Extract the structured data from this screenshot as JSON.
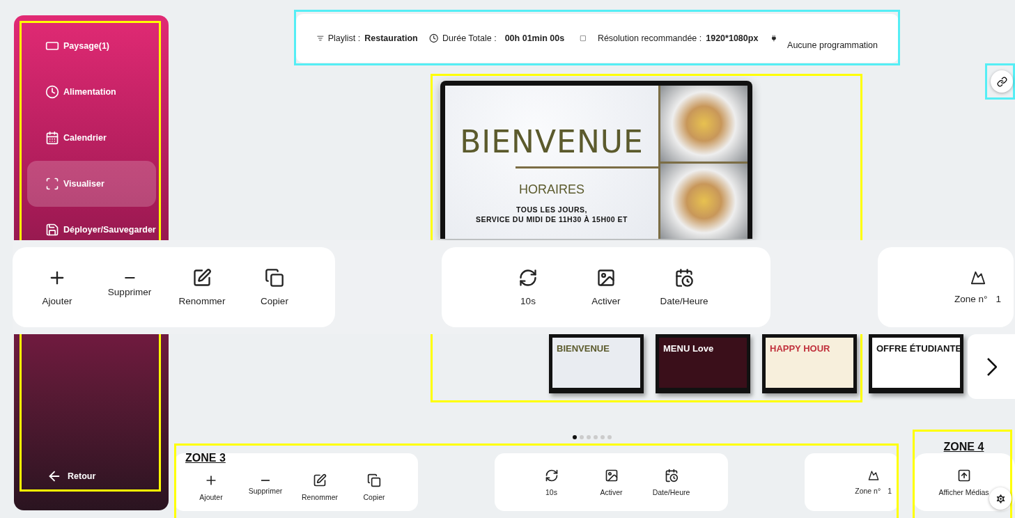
{
  "sidebar": {
    "items": [
      {
        "label": "Paysage(1)",
        "selected": false
      },
      {
        "label": "Alimentation",
        "selected": false
      },
      {
        "label": "Calendrier",
        "selected": false
      },
      {
        "label": "Visualiser",
        "selected": true
      },
      {
        "label": "Déployer/Sauvegarder",
        "selected": false
      }
    ],
    "back": "Retour"
  },
  "info_bar": {
    "playlist_label": "Playlist :",
    "playlist": "Restauration",
    "duration_label": "Durée Totale :",
    "duration": "00h 01min 00s",
    "resolution_label": "Résolution recommandée :",
    "resolution": "1920*1080px",
    "schedule": "Aucune programmation"
  },
  "preview": {
    "title": "BIENVENUE",
    "subtitle": "HORAIRES",
    "lines": [
      "TOUS LES JOURS,",
      "SERVICE DU MIDI DE 11H30 À 15H00 ET"
    ]
  },
  "toolbar": {
    "edit": [
      "Ajouter",
      "Supprimer",
      "Renommer",
      "Copier"
    ],
    "media": [
      "10s",
      "Activer",
      "Date/Heure"
    ],
    "zone_label": "Zone n°",
    "zone_number": "1"
  },
  "thumbnails": [
    {
      "title": "BIENVENUE"
    },
    {
      "title": "MENU Love"
    },
    {
      "title": "HAPPY HOUR"
    },
    {
      "title": "OFFRE ÉTUDIANTE"
    }
  ],
  "pages": [
    {
      "selected": true
    },
    {
      "selected": false
    },
    {
      "selected": false
    },
    {
      "selected": false
    },
    {
      "selected": false
    },
    {
      "selected": false
    }
  ],
  "zone3": {
    "heading": "ZONE 3",
    "edit": [
      "Ajouter",
      "Supprimer",
      "Renommer",
      "Copier"
    ],
    "media": [
      "10s",
      "Activer",
      "Date/Heure"
    ],
    "zone_label": "Zone n°",
    "zone_number": "1"
  },
  "zone4": {
    "heading": "ZONE 4",
    "action": "Afficher Médias"
  }
}
